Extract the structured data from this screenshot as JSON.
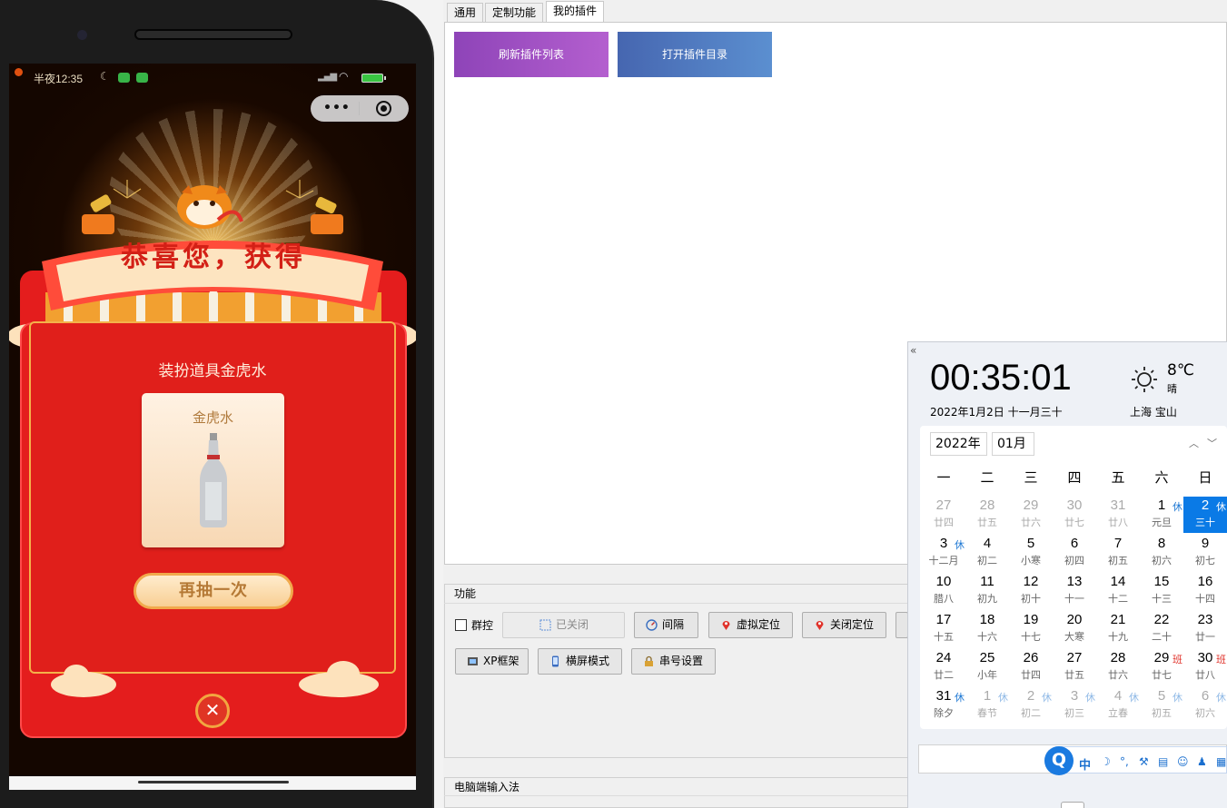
{
  "phone": {
    "status_time": "半夜12:35",
    "mini_capsule": {
      "more": "•••"
    },
    "banner": "恭喜您，获得",
    "prize_title": "装扮道具金虎水",
    "prize_name": "金虎水",
    "again_label": "再抽一次",
    "close_symbol": "✕"
  },
  "window": {
    "tabs": [
      "通用",
      "定制功能",
      "我的插件"
    ],
    "active_tab": "我的插件",
    "plugin_buttons": {
      "refresh": "刷新插件列表",
      "open_dir": "打开插件目录"
    },
    "function_group": {
      "title": "功能",
      "group_control_label": "群控",
      "group_control_checked": false,
      "buttons_row1": [
        "已关闭",
        "间隔",
        "虚拟定位",
        "关闭定位"
      ],
      "buttons_row2": [
        "XP框架",
        "横屏模式",
        "串号设置"
      ]
    },
    "ime_group": {
      "title": "电脑端输入法"
    }
  },
  "calendar": {
    "time": "00:35:01",
    "date_line": "2022年1月2日  十一月三十",
    "temperature": "8℃",
    "condition": "晴",
    "city": "上海 宝山",
    "year_select": "2022年",
    "month_select": "01月",
    "weekdays": [
      "一",
      "二",
      "三",
      "四",
      "五",
      "六",
      "日"
    ],
    "weeks": [
      [
        {
          "n": "27",
          "l": "廿四",
          "muted": true
        },
        {
          "n": "28",
          "l": "廿五",
          "muted": true
        },
        {
          "n": "29",
          "l": "廿六",
          "muted": true
        },
        {
          "n": "30",
          "l": "廿七",
          "muted": true
        },
        {
          "n": "31",
          "l": "廿八",
          "muted": true
        },
        {
          "n": "1",
          "l": "元旦",
          "m": "休"
        },
        {
          "n": "2",
          "l": "三十",
          "m": "休",
          "selected": true
        }
      ],
      [
        {
          "n": "3",
          "l": "十二月",
          "m": "休"
        },
        {
          "n": "4",
          "l": "初二"
        },
        {
          "n": "5",
          "l": "小寒"
        },
        {
          "n": "6",
          "l": "初四"
        },
        {
          "n": "7",
          "l": "初五"
        },
        {
          "n": "8",
          "l": "初六"
        },
        {
          "n": "9",
          "l": "初七"
        }
      ],
      [
        {
          "n": "10",
          "l": "腊八"
        },
        {
          "n": "11",
          "l": "初九"
        },
        {
          "n": "12",
          "l": "初十"
        },
        {
          "n": "13",
          "l": "十一"
        },
        {
          "n": "14",
          "l": "十二"
        },
        {
          "n": "15",
          "l": "十三"
        },
        {
          "n": "16",
          "l": "十四"
        }
      ],
      [
        {
          "n": "17",
          "l": "十五"
        },
        {
          "n": "18",
          "l": "十六"
        },
        {
          "n": "19",
          "l": "十七"
        },
        {
          "n": "20",
          "l": "大寒"
        },
        {
          "n": "21",
          "l": "十九"
        },
        {
          "n": "22",
          "l": "二十"
        },
        {
          "n": "23",
          "l": "廿一"
        }
      ],
      [
        {
          "n": "24",
          "l": "廿二"
        },
        {
          "n": "25",
          "l": "小年"
        },
        {
          "n": "26",
          "l": "廿四"
        },
        {
          "n": "27",
          "l": "廿五"
        },
        {
          "n": "28",
          "l": "廿六"
        },
        {
          "n": "29",
          "l": "廿七",
          "m": "班",
          "ban": true
        },
        {
          "n": "30",
          "l": "廿八",
          "m": "班",
          "ban": true
        }
      ],
      [
        {
          "n": "31",
          "l": "除夕",
          "m": "休"
        },
        {
          "n": "1",
          "l": "春节",
          "m": "休",
          "muted": true
        },
        {
          "n": "2",
          "l": "初二",
          "m": "休",
          "muted": true
        },
        {
          "n": "3",
          "l": "初三",
          "m": "休",
          "muted": true
        },
        {
          "n": "4",
          "l": "立春",
          "m": "休",
          "muted": true
        },
        {
          "n": "5",
          "l": "初五",
          "m": "休",
          "muted": true
        },
        {
          "n": "6",
          "l": "初六",
          "m": "休",
          "muted": true
        }
      ]
    ],
    "ime_toolbar": {
      "mode": "中"
    }
  }
}
